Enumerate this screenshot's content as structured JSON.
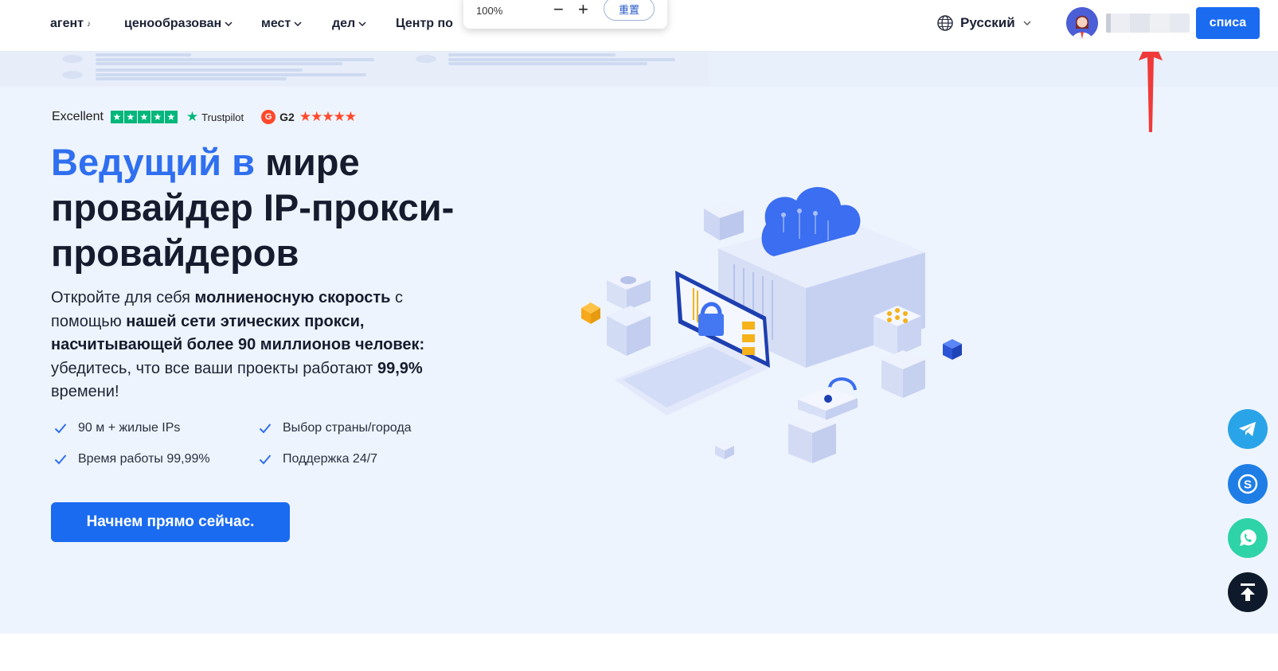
{
  "nav": {
    "items": [
      {
        "label": "агент",
        "suffix": "♪"
      },
      {
        "label": "ценообразован"
      },
      {
        "label": "мест"
      },
      {
        "label": "дел"
      },
      {
        "label": "Центр по"
      }
    ],
    "language": "Русский",
    "cta_label": "списа"
  },
  "zoom": {
    "percent": "100%",
    "minus": "−",
    "plus": "+",
    "reset_label": "重置"
  },
  "rating": {
    "excellent": "Excellent",
    "trustpilot_label": "Trustpilot",
    "g2_label": "G2",
    "trustpilot_stars": 5,
    "g2_stars": 4.5
  },
  "hero": {
    "headline_blue": "Ведущий в",
    "headline_rest": " мире провайдер IP-прокси-провайдеров",
    "desc_1": "Откройте для себя ",
    "desc_2": "молниеносную скорость",
    "desc_3": " с помощью ",
    "desc_4": "нашей сети этических прокси, насчитывающей более 90 миллионов человек:",
    "desc_5": " убедитесь, что все ваши проекты работают ",
    "desc_6": "99,9%",
    "desc_7": " времени!",
    "features": [
      "90 м + жилые IPs",
      "Выбор страны/города",
      "Время работы 99,99%",
      "Поддержка 24/7"
    ],
    "cta_label": "Начнем прямо сейчас."
  },
  "colors": {
    "brand_blue": "#1a6bf0",
    "headline_blue": "#2f6ff0",
    "hero_bg": "#eef4fd",
    "telegram": "#2aa4e8",
    "skype": "#1f7ee6",
    "whatsapp": "#2ed3a8",
    "top_button": "#0e1a2b",
    "arrow": "#f03a3a"
  },
  "floating": [
    "telegram-icon",
    "skype-icon",
    "whatsapp-icon",
    "arrow-up-to-top-icon"
  ]
}
